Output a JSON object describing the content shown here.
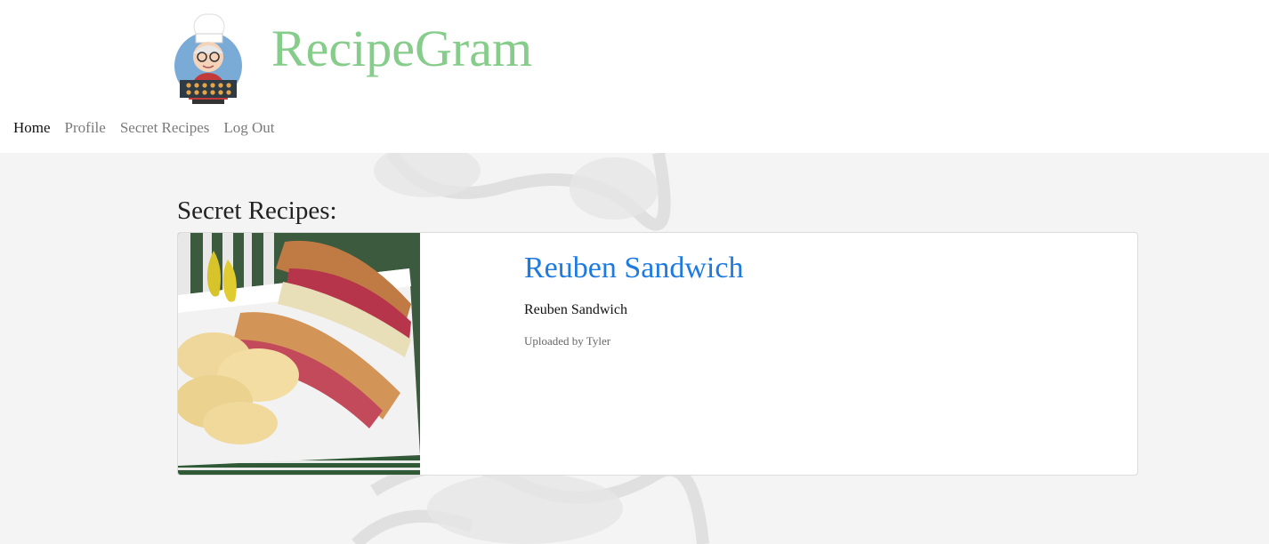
{
  "header": {
    "brand": "RecipeGram",
    "logo_icon": "chef-grandma-logo-icon"
  },
  "nav": {
    "items": [
      "Home",
      "Profile",
      "Secret Recipes",
      "Log Out"
    ],
    "active": "Home"
  },
  "main": {
    "title": "Secret Recipes:",
    "recipes": [
      {
        "title": "Reuben Sandwich",
        "description": "Reuben Sandwich",
        "uploaded_by": "Uploaded by Tyler"
      }
    ]
  },
  "colors": {
    "brand": "#86cc8a",
    "link": "#1f7ae0",
    "background": "#f4f4f4"
  }
}
